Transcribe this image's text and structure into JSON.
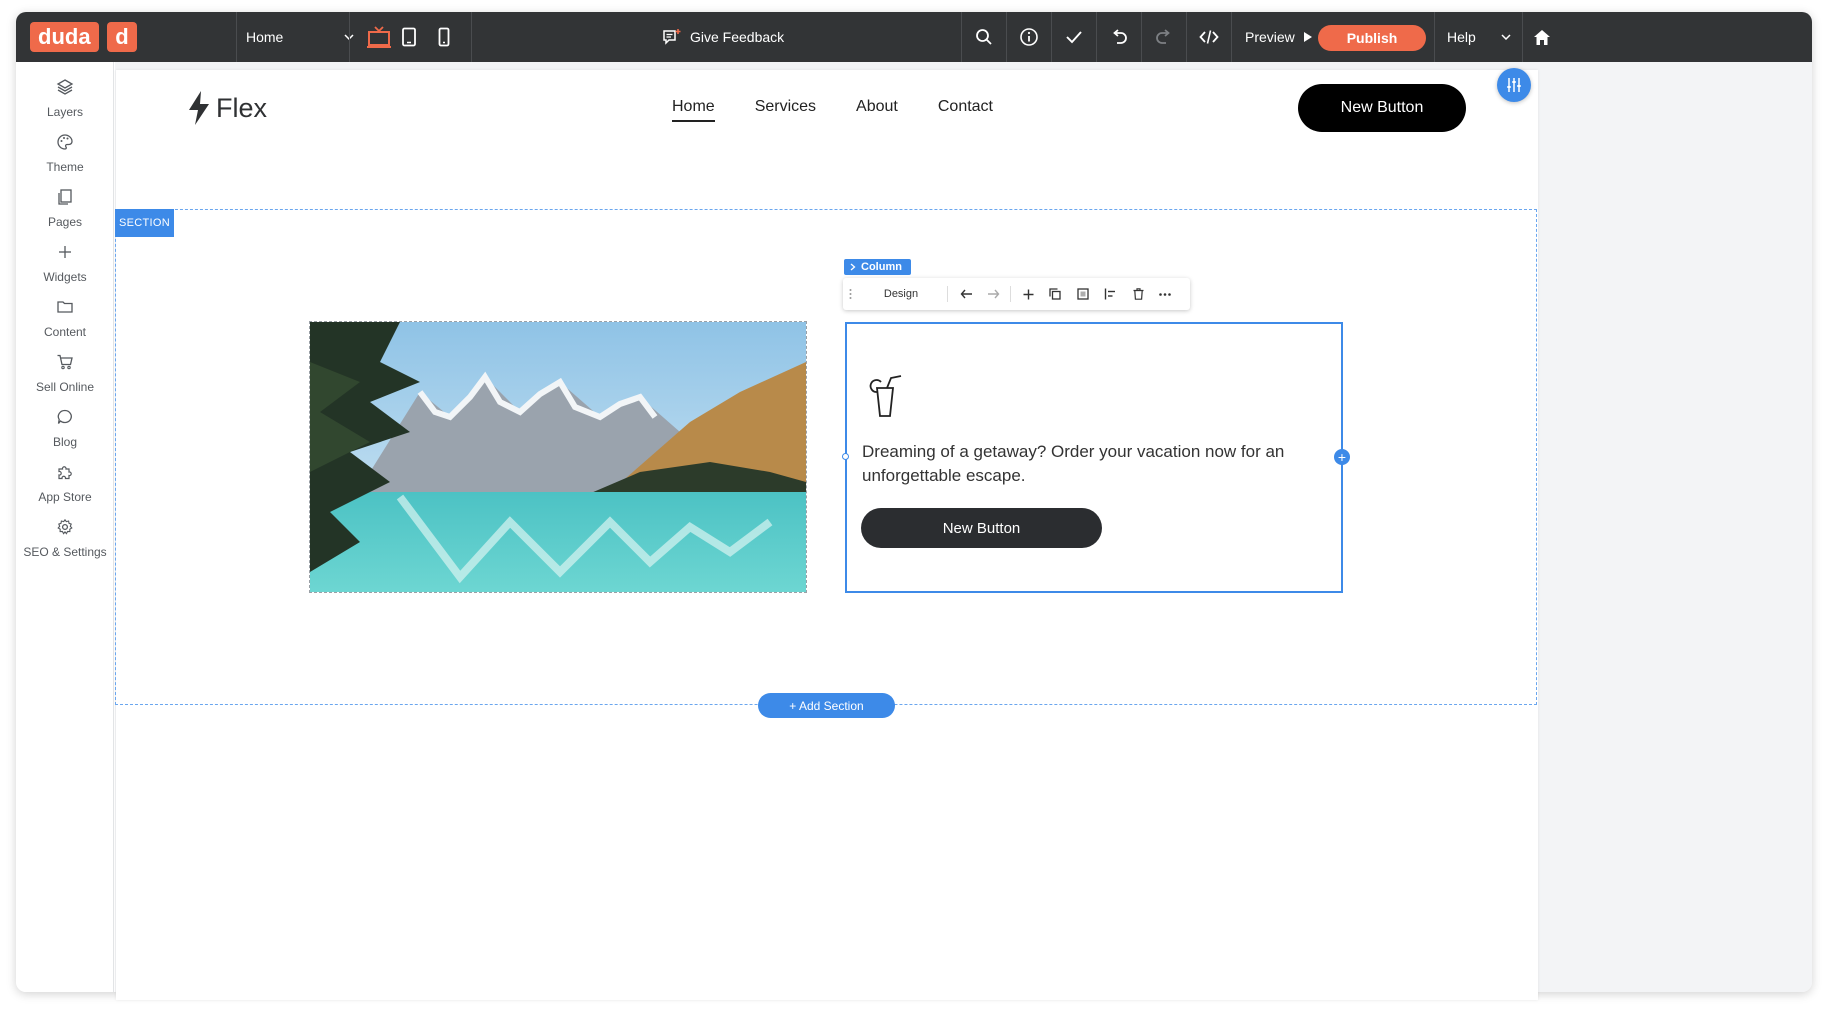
{
  "topbar": {
    "brand": "duda",
    "brand_mark": "d",
    "page_select": "Home",
    "feedback_label": "Give Feedback",
    "preview_label": "Preview",
    "publish_label": "Publish",
    "help_label": "Help"
  },
  "sidebar": {
    "items": [
      {
        "label": "Layers",
        "icon": "layers-icon"
      },
      {
        "label": "Theme",
        "icon": "palette-icon"
      },
      {
        "label": "Pages",
        "icon": "pages-icon"
      },
      {
        "label": "Widgets",
        "icon": "plus-icon"
      },
      {
        "label": "Content",
        "icon": "folder-icon"
      },
      {
        "label": "Sell Online",
        "icon": "cart-icon"
      },
      {
        "label": "Blog",
        "icon": "chat-bubble-icon"
      },
      {
        "label": "App Store",
        "icon": "puzzle-icon"
      },
      {
        "label": "SEO & Settings",
        "icon": "gear-icon"
      }
    ]
  },
  "site": {
    "logo_text": "Flex",
    "nav": [
      "Home",
      "Services",
      "About",
      "Contact"
    ],
    "header_button": "New Button"
  },
  "editor": {
    "section_tag": "SECTION",
    "column_tag": "Column",
    "toolbar_design": "Design",
    "add_section": "+ Add Section"
  },
  "content": {
    "body_text": "Dreaming of a getaway? Order your vacation now for an unforgettable escape.",
    "button_label": "New Button"
  },
  "colors": {
    "accent_orange": "#ef6a4a",
    "editor_blue": "#3d8ae8",
    "toolbar_dark": "#323436"
  }
}
